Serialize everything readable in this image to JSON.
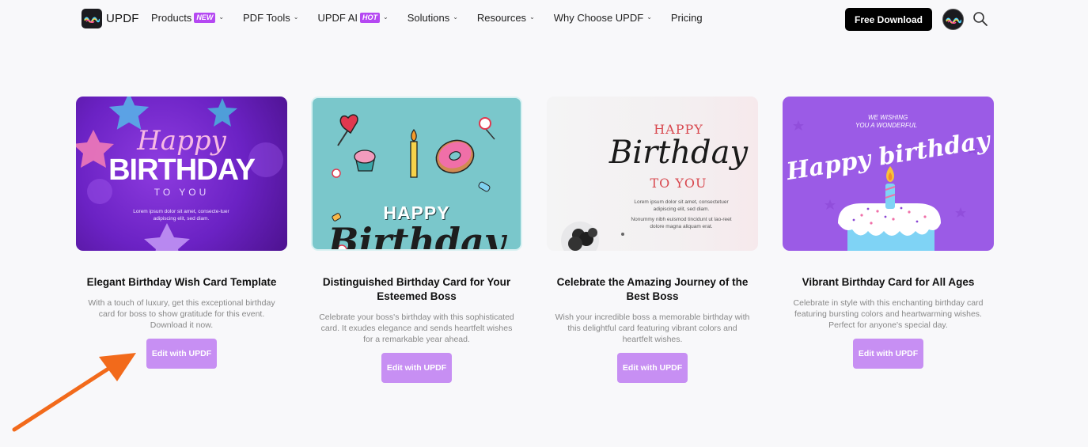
{
  "nav": {
    "logo_text": "UPDF",
    "items": [
      {
        "label": "Products",
        "badge": "NEW",
        "has_chevron": true
      },
      {
        "label": "PDF Tools",
        "badge": "",
        "has_chevron": true
      },
      {
        "label": "UPDF AI",
        "badge": "HOT",
        "has_chevron": true
      },
      {
        "label": "Solutions",
        "badge": "",
        "has_chevron": true
      },
      {
        "label": "Resources",
        "badge": "",
        "has_chevron": true
      },
      {
        "label": "Why Choose UPDF",
        "badge": "",
        "has_chevron": true
      },
      {
        "label": "Pricing",
        "badge": "",
        "has_chevron": false
      }
    ],
    "cta": "Free Download",
    "icons": {
      "avatar": "user-avatar-icon",
      "search": "search-icon",
      "chevron": "chevron-down-icon"
    }
  },
  "colors": {
    "accent": "#c78ff3",
    "badge": "#b548f2",
    "cta_bg": "#000000"
  },
  "cards": [
    {
      "title": "Elegant Birthday Wish Card Template",
      "description": "With a touch of luxury, get this exceptional birthday card for boss to show gratitude for this event. Download it now.",
      "button": "Edit with UPDF",
      "thumb": {
        "line1": "Happy",
        "line2": "BIRTHDAY",
        "line3": "TO YOU",
        "body": "Lorem ipsum dolor sit amet, consecte-tuer adipiscing elit, sed diam."
      }
    },
    {
      "title": "Distinguished Birthday Card for Your Esteemed Boss",
      "description": "Celebrate your boss's birthday with this sophisticated card. It exudes elegance and sends heartfelt wishes for a remarkable year ahead.",
      "button": "Edit with UPDF",
      "thumb": {
        "line1": "HAPPY",
        "line2": "Birthday"
      }
    },
    {
      "title": "Celebrate the Amazing Journey of the Best Boss",
      "description": "Wish your incredible boss a memorable birthday with this delightful card featuring vibrant colors and heartfelt wishes.",
      "button": "Edit with UPDF",
      "thumb": {
        "line1": "HAPPY",
        "line2": "Birthday",
        "line3": "TO YOU",
        "body1": "Lorem ipsum dolor sit amet, consectetuer adipiscing elit, sed diam.",
        "body2": "Nonummy nibh euismod tincidunt ut lao-reet dolore magna aliquam erat."
      }
    },
    {
      "title": "Vibrant Birthday Card for All Ages",
      "description": "Celebrate in style with this enchanting birthday card featuring bursting colors and heartwarming wishes. Perfect for anyone's special day.",
      "button": "Edit with UPDF",
      "thumb": {
        "line1": "WE WISHING",
        "line2": "YOU A WONDERFUL",
        "line3": "Happy birthday"
      }
    }
  ]
}
